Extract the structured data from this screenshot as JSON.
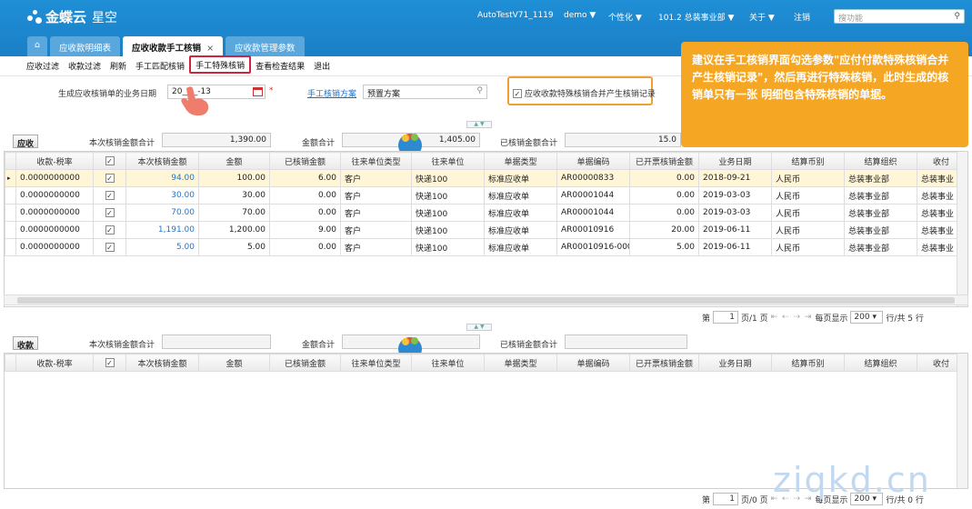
{
  "header": {
    "logo_text": "金蝶云",
    "logo_sub": "星空",
    "user_account": "AutoTestV71_1119",
    "user": "demo ▼",
    "personalize": "个性化 ▼",
    "org": "101.2 总装事业部 ▼",
    "about": "关于 ▼",
    "logout": "注销",
    "search_placeholder": "搜功能"
  },
  "tabs": [
    {
      "label": "应收款明细表"
    },
    {
      "label": "应收收款手工核销",
      "close": "×"
    },
    {
      "label": "应收款管理参数"
    }
  ],
  "toolbar": [
    "应收过滤",
    "收款过滤",
    "刷新",
    "手工匹配核销",
    "手工特殊核销",
    "查看检查结果",
    "退出"
  ],
  "form": {
    "date_label": "生成应收核销单的业务日期",
    "date_value": "20__-_-13",
    "required_mark": "*",
    "plan_link": "手工核销方案",
    "plan_value": "预置方案",
    "merge_checkbox_label": "应收收款特殊核销合并产生核销记录",
    "merge_checked": "✓"
  },
  "tooltip": "建议在手工核销界面勾选参数\"应付付款特殊核销合并产生核销记录\"，然后再进行特殊核销，此时生成的核销单只有一张 明细包含特殊核销的单据。",
  "ar_section": {
    "title": "应收",
    "sum_label": "本次核销金额合计",
    "sum_value": "1,390.00",
    "amount_label": "金额合计",
    "amount_value": "1,405.00",
    "written_label": "已核销金额合计",
    "written_value": "15.0",
    "columns": [
      "收款-税率",
      "✓",
      "本次核销金额",
      "金额",
      "已核销金额",
      "往来单位类型",
      "往来单位",
      "单据类型",
      "单据编码",
      "已开票核销金额",
      "业务日期",
      "结算币别",
      "结算组织",
      "收付"
    ],
    "rows": [
      [
        "0.0000000000",
        "✓",
        "94.00",
        "100.00",
        "6.00",
        "客户",
        "快递100",
        "标准应收单",
        "AR00000833",
        "0.00",
        "2018-09-21",
        "人民币",
        "总装事业部",
        "总装事业"
      ],
      [
        "0.0000000000",
        "✓",
        "30.00",
        "30.00",
        "0.00",
        "客户",
        "快递100",
        "标准应收单",
        "AR00001044",
        "0.00",
        "2019-03-03",
        "人民币",
        "总装事业部",
        "总装事业"
      ],
      [
        "0.0000000000",
        "✓",
        "70.00",
        "70.00",
        "0.00",
        "客户",
        "快递100",
        "标准应收单",
        "AR00001044",
        "0.00",
        "2019-03-03",
        "人民币",
        "总装事业部",
        "总装事业"
      ],
      [
        "0.0000000000",
        "✓",
        "1,191.00",
        "1,200.00",
        "9.00",
        "客户",
        "快递100",
        "标准应收单",
        "AR00010916",
        "20.00",
        "2019-06-11",
        "人民币",
        "总装事业部",
        "总装事业"
      ],
      [
        "0.0000000000",
        "✓",
        "5.00",
        "5.00",
        "0.00",
        "客户",
        "快递100",
        "标准应收单",
        "AR00010916-000",
        "5.00",
        "2019-06-11",
        "人民币",
        "总装事业部",
        "总装事业"
      ]
    ],
    "pager": {
      "prefix": "第",
      "page": "1",
      "page_of": "页/1 页",
      "nav": "⇤ ⇠ ⇢ ⇥",
      "per_page_label": "每页显示",
      "per_page": "200",
      "total": "行/共 5 行"
    }
  },
  "rec_section": {
    "title": "收款",
    "sum_label": "本次核销金额合计",
    "amount_label": "金额合计",
    "written_label": "已核销金额合计",
    "columns": [
      "收款-税率",
      "✓",
      "本次核销金额",
      "金额",
      "已核销金额",
      "往来单位类型",
      "往来单位",
      "单据类型",
      "单据编码",
      "已开票核销金额",
      "业务日期",
      "结算币别",
      "结算组织",
      "收付"
    ],
    "pager": {
      "prefix": "第",
      "page": "1",
      "page_of": "页/0 页",
      "nav": "⇤ ⇠ ⇢ ⇥",
      "per_page_label": "每页显示",
      "per_page": "200",
      "total": "行/共 0 行"
    }
  },
  "watermark": "ziqkd.cn",
  "colors": {
    "brand_blue": "#1a84cc",
    "tooltip_orange": "#f5a623",
    "highlight_red": "#d0233f",
    "link_blue": "#1c72c9"
  }
}
